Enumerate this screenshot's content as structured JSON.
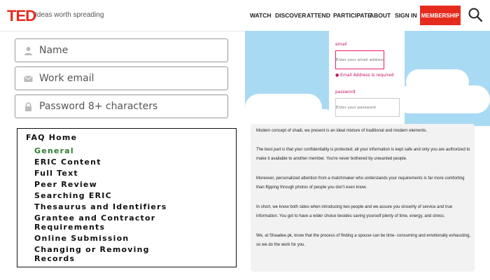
{
  "header": {
    "logo": "TED",
    "tagline": "Ideas worth spreading",
    "nav": [
      "WATCH",
      "DISCOVER",
      "ATTEND",
      "PARTICIPATE",
      "ABOUT",
      "SIGN IN"
    ],
    "membership": "MEMBERSHIP",
    "accent": "#e62b1e"
  },
  "signup": {
    "name": "Name",
    "email": "Work email",
    "password": "Password 8+ characters"
  },
  "faq": {
    "items": [
      "FAQ Home",
      "General",
      "ERIC Content",
      "Full Text",
      "Peer Review",
      "Searching ERIC",
      "Thesaurus and Identifiers",
      "Grantee and Contractor",
      "Requirements",
      "Online Submission",
      "Changing or Removing",
      "Records"
    ]
  },
  "login": {
    "email_label": "email",
    "email_placeholder": "Enter your email address",
    "email_error": "Email Address is required",
    "password_label": "password",
    "password_placeholder": "Enter your password"
  },
  "article": {
    "paragraphs": [
      "Modern concept of shadi, we present is an ideal mixture of traditional and modern elements.",
      "The best part is that your confidentiality is protected; all your information is kept safe and only you are authorized to make it available to another member. You're never bothered by unwanted people.",
      "Moreover, personalized attention from a matchmaker who understands your requirements is far more comforting than flipping through photos of people you don't even know.",
      "In short, we know both sides when introducing two people and we assure you sincerity of service and true information. You got to have a wider choice besides saving yourself plenty of time, energy, and stress.",
      "We, at Shaadee.pk, know that the process of finding a spouse can be time- consuming and emotionally exhausting, so we do the work for you."
    ]
  }
}
